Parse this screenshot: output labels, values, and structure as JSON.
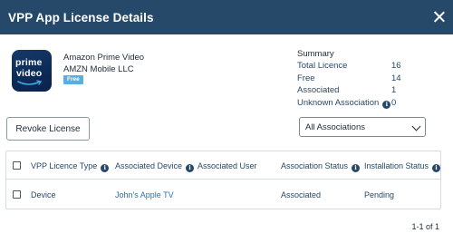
{
  "dialog": {
    "title": "VPP App License Details"
  },
  "app": {
    "name": "Amazon Prime Video",
    "developer": "AMZN Mobile LLC",
    "badge": "Free",
    "icon": "prime-video-app-icon",
    "icon_text_1": "prime",
    "icon_text_2": "video"
  },
  "summary": {
    "title": "Summary",
    "rows": [
      {
        "label": "Total Licence",
        "value": "16"
      },
      {
        "label": "Free",
        "value": "14"
      },
      {
        "label": "Associated",
        "value": "1"
      },
      {
        "label": "Unknown Association",
        "value": "0"
      }
    ]
  },
  "actions": {
    "revoke_label": "Revoke License"
  },
  "filter": {
    "selected": "All Associations"
  },
  "table": {
    "columns": [
      "VPP Licence Type",
      "Associated Device",
      "Associated User",
      "Association Status",
      "Installation Status"
    ],
    "rows": [
      {
        "type": "Device",
        "device": "John's Apple TV",
        "user": "",
        "association_status": "Associated",
        "installation_status": "Pending"
      }
    ]
  },
  "pagination": {
    "text": "1-1 of 1"
  },
  "colors": {
    "header": "#26496a",
    "badge": "#5aaee0",
    "link": "#2c6fb4"
  }
}
